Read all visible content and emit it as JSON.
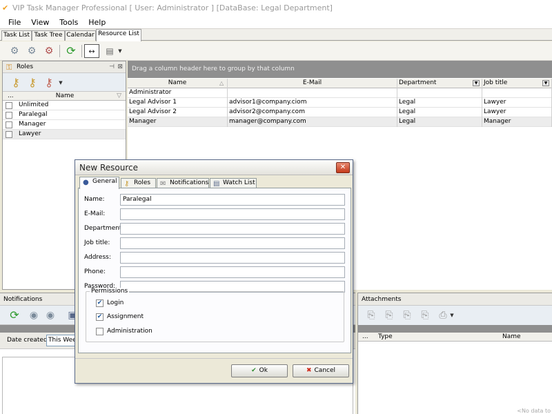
{
  "window": {
    "title": "VIP Task Manager Professional [ User: Administrator ] [DataBase: Legal Department]"
  },
  "menu": [
    "File",
    "View",
    "Tools",
    "Help"
  ],
  "tabs": [
    "Task List",
    "Task Tree",
    "Calendar",
    "Resource List"
  ],
  "active_tab": "Resource List",
  "roles_panel": {
    "title": "Roles",
    "pin_glyph": "⊣",
    "close_glyph": "⊠",
    "column_dots": "...",
    "column_name": "Name",
    "roles": [
      "Unlimited",
      "Paralegal",
      "Manager",
      "Lawyer"
    ]
  },
  "resource_grid": {
    "group_hint": "Drag a column header here to group by that column",
    "columns": [
      "Name",
      "E-Mail",
      "Department",
      "Job title"
    ],
    "rows": [
      {
        "name": "Administrator",
        "email": "",
        "department": "",
        "job_title": ""
      },
      {
        "name": "Legal Advisor 1",
        "email": "advisor1@company.ciom",
        "department": "Legal",
        "job_title": "Lawyer"
      },
      {
        "name": "Legal Advisor 2",
        "email": "advisor2@company.com",
        "department": "Legal",
        "job_title": "Lawyer"
      },
      {
        "name": "Manager",
        "email": "manager@company.com",
        "department": "Legal",
        "job_title": "Manager"
      }
    ]
  },
  "notifications_panel": {
    "title": "Notifications",
    "date_label": "Date created:",
    "date_value": "This Week"
  },
  "attachments_panel": {
    "title": "Attachments",
    "col_dots": "...",
    "col_type": "Type",
    "col_name": "Name",
    "no_data": "<No data to"
  },
  "dialog": {
    "title": "New Resource",
    "close_glyph": "✕",
    "tabs": [
      "General",
      "Roles",
      "Notifications",
      "Watch List"
    ],
    "fields": {
      "name": {
        "label": "Name:",
        "value": "Paralegal"
      },
      "email": {
        "label": "E-Mail:",
        "value": ""
      },
      "department": {
        "label": "Department:",
        "value": ""
      },
      "job_title": {
        "label": "Job title:",
        "value": ""
      },
      "address": {
        "label": "Address:",
        "value": ""
      },
      "phone": {
        "label": "Phone:",
        "value": ""
      },
      "password": {
        "label": "Password:",
        "value": ""
      }
    },
    "permissions": {
      "legend": "Permissions",
      "items": [
        {
          "label": "Login",
          "checked": true
        },
        {
          "label": "Assignment",
          "checked": true
        },
        {
          "label": "Administration",
          "checked": false
        }
      ]
    },
    "ok_label": "Ok",
    "cancel_label": "Cancel"
  },
  "colors": {
    "group_bar": "#8f8f8f",
    "ok_icon": "#2e8b2e",
    "cancel_icon": "#d02a1a",
    "close_button": "#c43a1a"
  },
  "icons": {
    "app": "app-check-icon",
    "roles": "roles-key-icon",
    "refresh": "refresh-icon",
    "ok": "check-icon",
    "cancel": "x-icon"
  }
}
